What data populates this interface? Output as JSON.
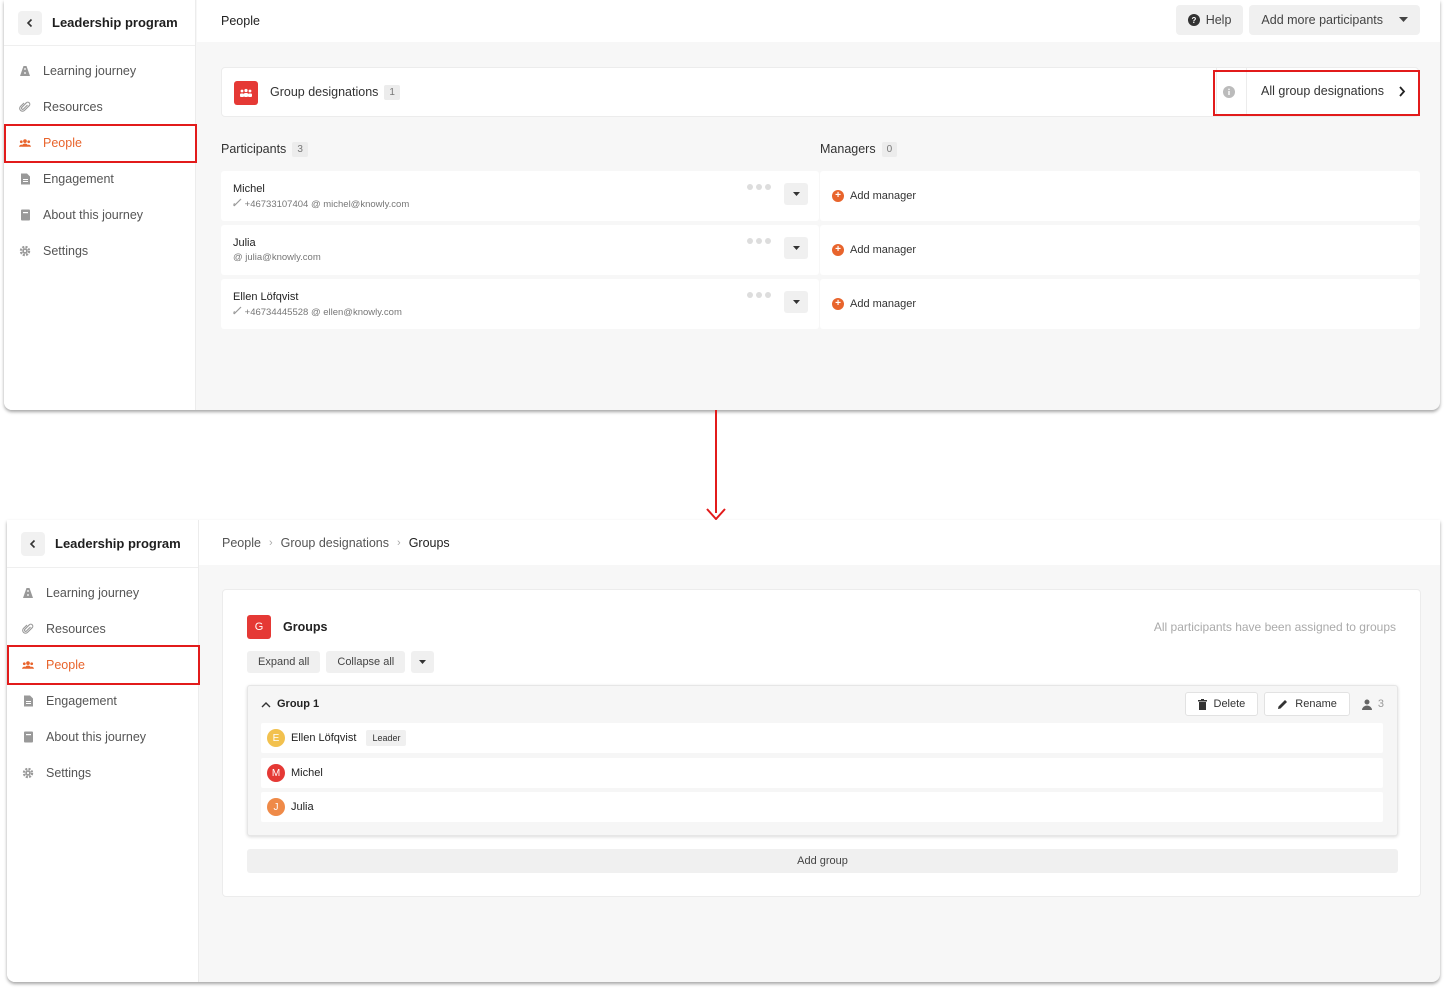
{
  "colors": {
    "accent": "#e8642c",
    "highlight": "#e21b1b",
    "brand_red": "#e53935"
  },
  "sidebar": {
    "title": "Leadership program",
    "items": [
      {
        "label": "Learning journey",
        "icon": "road-icon"
      },
      {
        "label": "Resources",
        "icon": "paperclip-icon"
      },
      {
        "label": "People",
        "icon": "users-icon",
        "active": true
      },
      {
        "label": "Engagement",
        "icon": "document-icon"
      },
      {
        "label": "About this journey",
        "icon": "book-icon"
      },
      {
        "label": "Settings",
        "icon": "gear-icon"
      }
    ]
  },
  "screen1": {
    "page_title": "People",
    "help_label": "Help",
    "add_participants_label": "Add more participants",
    "group_designations": {
      "label": "Group designations",
      "count": "1",
      "all_label": "All group designations"
    },
    "participants": {
      "label": "Participants",
      "count": "3"
    },
    "managers": {
      "label": "Managers",
      "count": "0",
      "add_label": "Add manager"
    },
    "people": [
      {
        "name": "Michel",
        "meta": "+46733107404 @ michel@knowly.com"
      },
      {
        "name": "Julia",
        "meta": "@ julia@knowly.com"
      },
      {
        "name": "Ellen Löfqvist",
        "meta": "+46734445528 @ ellen@knowly.com"
      }
    ]
  },
  "screen2": {
    "breadcrumb": [
      "People",
      "Group designations",
      "Groups"
    ],
    "groups_title": "Groups",
    "groups_icon_letter": "G",
    "status": "All participants have been assigned to groups",
    "expand_all": "Expand all",
    "collapse_all": "Collapse all",
    "group": {
      "name": "Group 1",
      "delete_label": "Delete",
      "rename_label": "Rename",
      "member_count": "3",
      "members": [
        {
          "initial": "E",
          "name": "Ellen Löfqvist",
          "tag": "Leader",
          "color": "#f2c14e"
        },
        {
          "initial": "M",
          "name": "Michel",
          "color": "#e53935"
        },
        {
          "initial": "J",
          "name": "Julia",
          "color": "#ef8a48"
        }
      ]
    },
    "add_group": "Add group"
  }
}
